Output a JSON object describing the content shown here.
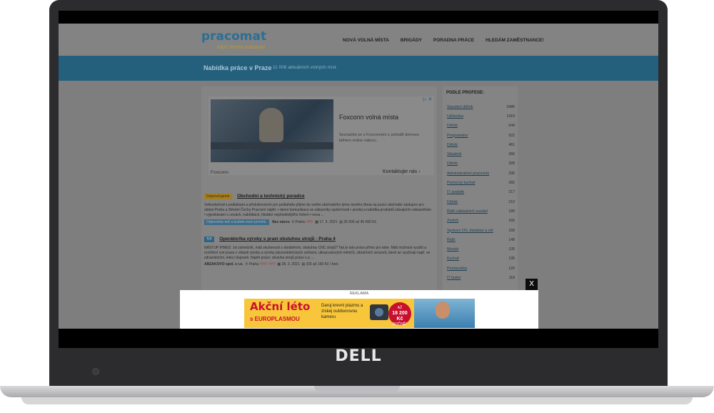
{
  "device": {
    "brand": "DELL"
  },
  "site": {
    "logo": "pracomat",
    "tagline": "když chcete pracovat!",
    "nav": [
      "NOVÁ VOLNÁ MÍSTA",
      "BRIGÁDY",
      "PORADNA PRÁCE",
      "HLEDÁM ZAMĚSTNANCE!"
    ],
    "banner_title": "Nabídka práce v Praze",
    "banner_sub": "11 008 aktuálních volných míst"
  },
  "ad": {
    "title": "Foxconn volná místa",
    "description": "Seznamte se s Foxconnem z pohodlí domova během online náboru.",
    "advertiser": "Foxconn",
    "cta": "Kontaktujte nás",
    "cta_chevron": "›"
  },
  "jobs": [
    {
      "badge": "Doporučujeme",
      "title": "Obchodní a technický poradce",
      "desc": "Velkoobchod s podlahami a příslušenstvím pro podlaháře přijme do svého obchodního týmu nového člena na pozici obchodní zástupce pro oblast Praha a Střední Čechy Pracovní náplň: • denní komunikace se zákazníky společnosti • prodej a nabídka produktů stávajícím zákazníkům • vyjednávání o cenách, nabídkách, hledání nejvhodnějšího řešení • nova ...",
      "cta": "Odpovězte teď a budete mezi prvními.",
      "company": "Bez názvu",
      "location": "Praha",
      "type": "HPP",
      "date": "17. 3. 2021",
      "salary": "35 000 až 45 000 Kč"
    },
    {
      "badge": "TIP",
      "title": "Operátor/ka výroby s praxí obsluhou strojů - Praha 4",
      "desc": "NÁSTUP IHNED. Jsi zámečník, máš zkušenosti s obráběním, obsluhou CNC strojů? Tak je tato práce přímo pro tebe. Máš možnost využití a rozšíření své praxe v oblasti výroby a výroby piezoelektrických zařízení, ultrazvukových měničů, vibračních senzorů, které se využívají např. ve zdravotnictví, letecí dopravě. Náplň práce: obsluha strojů práce s p ...",
      "cta": "",
      "company": "ABZAKOVO spol. s r.o.",
      "location": "Praha",
      "type": "HPP, VPP",
      "date": "28. 3. 2021",
      "salary": "165 až 190 Kč / hod."
    }
  ],
  "sidebar": {
    "title": "PODLE PROFESE:",
    "items": [
      {
        "name": "Stavební dělník",
        "count": "2485"
      },
      {
        "name": "Uklízečka",
        "count": "1419"
      },
      {
        "name": "Dělník",
        "count": "644"
      },
      {
        "name": "Programátor",
        "count": "522"
      },
      {
        "name": "Dělník",
        "count": "461"
      },
      {
        "name": "Skladník",
        "count": "366"
      },
      {
        "name": "Dělník",
        "count": "328"
      },
      {
        "name": "Administrativní pracovník",
        "count": "295"
      },
      {
        "name": "Pomocný kuchař",
        "count": "282"
      },
      {
        "name": "IT analytik",
        "count": "217"
      },
      {
        "name": "Dělník",
        "count": "210"
      },
      {
        "name": "Řidič nákladních vozidel",
        "count": "189"
      },
      {
        "name": "Zedník",
        "count": "165"
      },
      {
        "name": "Správce OS, databází a sítí",
        "count": "158"
      },
      {
        "name": "Řidič",
        "count": "148"
      },
      {
        "name": "Montér",
        "count": "135"
      },
      {
        "name": "Kuchař",
        "count": "135"
      },
      {
        "name": "Prodavačka",
        "count": "120"
      },
      {
        "name": "IT tester",
        "count": "118"
      }
    ]
  },
  "overlay": {
    "label": "REKLAMA",
    "close": "X",
    "headline": "Akční léto",
    "subline": "s EUROPLASMOU",
    "offer": "Daruj krevní plazmu a získej outdoorovou kameru",
    "price_line1": "AŽ",
    "price_amount": "18 200 Kč",
    "price_line2": "ROČNĚ*"
  }
}
